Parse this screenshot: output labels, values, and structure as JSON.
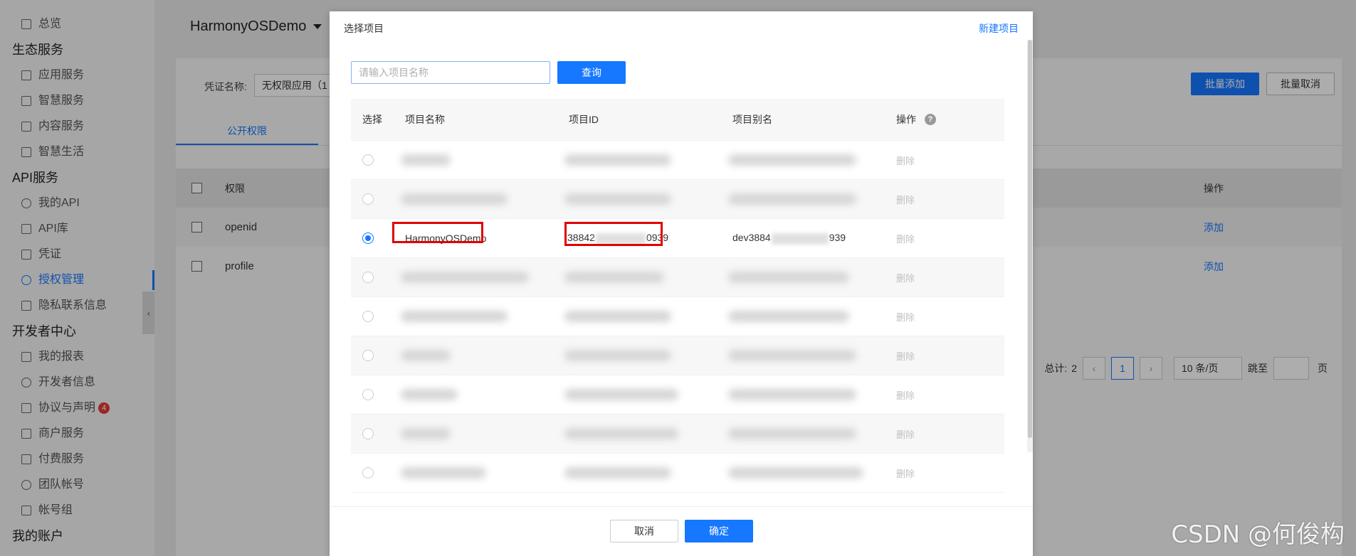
{
  "sidebar": {
    "top_item": "总览",
    "groups": [
      {
        "title": "生态服务",
        "items": [
          "应用服务",
          "智慧服务",
          "内容服务",
          "智慧生活"
        ]
      },
      {
        "title": "API服务",
        "items": [
          "我的API",
          "API库",
          "凭证",
          "授权管理",
          "隐私联系信息"
        ]
      },
      {
        "title": "开发者中心",
        "items": [
          "我的报表",
          "开发者信息",
          "协议与声明",
          "商户服务",
          "付费服务",
          "团队帐号",
          "帐号组"
        ]
      },
      {
        "title": "我的账户",
        "items": []
      }
    ],
    "active_item": "授权管理",
    "badge_count": "4",
    "collapse_glyph": "‹"
  },
  "page": {
    "app_name": "HarmonyOSDemo",
    "credential_label": "凭证名称:",
    "credential_value": "无权限应用（1",
    "batch_add": "批量添加",
    "batch_cancel": "批量取消",
    "tab_public": "公开权限",
    "table": {
      "col_permission": "权限",
      "col_action": "操作",
      "rows": [
        {
          "name": "openid",
          "action": "添加"
        },
        {
          "name": "profile",
          "action": "添加"
        }
      ]
    },
    "pager": {
      "total_label": "总计:",
      "total": "2",
      "prev": "‹",
      "current": "1",
      "next": "›",
      "page_size": "10 条/页",
      "goto_label": "跳至",
      "page_unit": "页"
    }
  },
  "modal": {
    "title": "选择项目",
    "new_project": "新建项目",
    "search_placeholder": "请输入项目名称",
    "search_button": "查询",
    "columns": {
      "select": "选择",
      "name": "项目名称",
      "id": "项目ID",
      "alias": "项目别名",
      "action": "操作"
    },
    "help_glyph": "?",
    "delete_label": "删除",
    "selected_row": {
      "name": "HarmonyOSDemo",
      "id_prefix": "38842",
      "id_suffix": "0939",
      "alias_prefix": "dev3884",
      "alias_suffix": "939"
    },
    "cancel": "取消",
    "confirm": "确定"
  },
  "watermark": "CSDN @何俊构",
  "colors": {
    "primary": "#1677ff",
    "highlight": "#e00000"
  }
}
